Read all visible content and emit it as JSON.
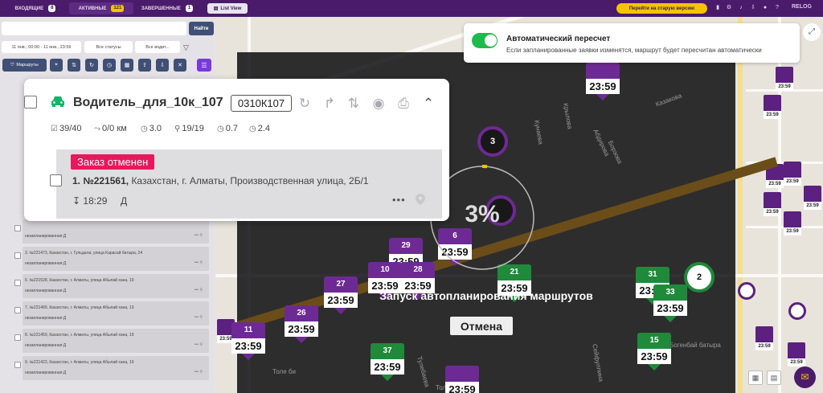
{
  "topbar": {
    "tabs": [
      {
        "label": "ВХОДЯЩИЕ",
        "count": "8"
      },
      {
        "label": "АКТИВНЫЕ",
        "count": "121"
      },
      {
        "label": "ЗАВЕРШЕННЫЕ",
        "count": "1"
      }
    ],
    "list_view": "List View",
    "old_version": "Перейти на старую версию",
    "brand": "RELOG"
  },
  "left_panel": {
    "find_button": "Найти",
    "date_filter": "11 янв., 00:00 - 11 янв., 23:59",
    "status_filter": "Все статусы",
    "driver_filter": "Все водит...",
    "routes_button": "Маршруты",
    "orders": [
      {
        "title": "",
        "status": "незапланированная   Д"
      },
      {
        "title": "3. №221473, Казахстан, г. Гульдала, улица Карасай батыра, 24",
        "status": "незапланированная   Д"
      },
      {
        "title": "6. №221528, Казахстан, г. Алматы, улица Абылай хана, 19",
        "status": "незапланированная   Д"
      },
      {
        "title": "7. №221499, Казахстан, г. Алматы, улица Абылай хана, 19",
        "status": "незапланированная   Д"
      },
      {
        "title": "8. №221459, Казахстан, г. Алматы, улица Абылай хана, 19",
        "status": "незапланированная   Д"
      },
      {
        "title": "9. №221423, Казахстан, г. Алматы, улица Абылай хана, 19",
        "status": "незапланированная   Д"
      }
    ]
  },
  "recalc": {
    "title": "Автоматический пересчет",
    "description": "Если запланированные заявки изменятся, маршрут будет пересчитан автоматически",
    "enabled": true,
    "color": "#1dbb4a"
  },
  "driver": {
    "name": "Водитель_для_10к_107",
    "plate": "0310К107",
    "stats": [
      {
        "icon": "checklist-icon",
        "value": "39/40"
      },
      {
        "icon": "route-icon",
        "value": "0/0 км"
      },
      {
        "icon": "clock-icon",
        "value": "3.0"
      },
      {
        "icon": "pin-icon",
        "value": "19/19"
      },
      {
        "icon": "clock-icon",
        "value": "0.7"
      },
      {
        "icon": "clock-icon",
        "value": "2.4"
      }
    ],
    "order": {
      "badge": "Заказ отменен",
      "badge_color": "#e8185c",
      "number": "1. №221561,",
      "address": " Казахстан, г. Алматы, Производственная улица, 2Б/1",
      "time": "↧ 18:29",
      "type": "Д"
    }
  },
  "progress": {
    "percent_label": "3%",
    "value": 0.03,
    "label": "Запуск автопланирования маршрутов",
    "cancel": "Отмена"
  },
  "map": {
    "time_label": "23:59",
    "streets": [
      "Абдирова",
      "Борзова",
      "Казакова",
      "Кунаева",
      "Крылова",
      "Толе би",
      "Тулебаева",
      "Толе би",
      "Сейфуллина",
      "Богенбай батыра"
    ],
    "dark_pins": [
      {
        "num": "29",
        "color": "#6e2a94"
      },
      {
        "num": "6",
        "color": "#6e2a94"
      },
      {
        "num": "10",
        "color": "#6e2a94"
      },
      {
        "num": "28",
        "color": "#6e2a94"
      },
      {
        "num": "27",
        "color": "#6e2a94"
      },
      {
        "num": "26",
        "color": "#6e2a94"
      },
      {
        "num": "11",
        "color": "#6e2a94"
      },
      {
        "num": "37",
        "color": "#1f8a3a"
      },
      {
        "num": "21",
        "color": "#1f8a3a"
      },
      {
        "num": "31",
        "color": "#1f8a3a"
      },
      {
        "num": "33",
        "color": "#1f8a3a"
      },
      {
        "num": "15",
        "color": "#1f8a3a"
      },
      {
        "num": "",
        "color": "#6e2a94"
      }
    ],
    "dark_clusters": [
      "3",
      "2"
    ]
  }
}
